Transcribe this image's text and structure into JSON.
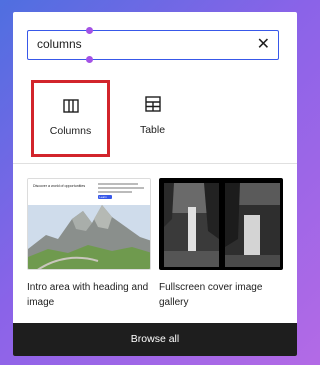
{
  "search": {
    "value": "columns"
  },
  "blocks": [
    {
      "label": "Columns",
      "icon": "columns-icon",
      "selected": true
    },
    {
      "label": "Table",
      "icon": "table-icon",
      "selected": false
    }
  ],
  "patterns": [
    {
      "label": "Intro area with heading and image",
      "thumb_heading": "Discover a world of opportunities",
      "thumb_button": "Learn"
    },
    {
      "label": "Fullscreen cover image gallery"
    }
  ],
  "footer": {
    "browse_label": "Browse all"
  },
  "colors": {
    "accent": "#3858e9",
    "selection": "#d2242b",
    "footer_bg": "#1e1e1e"
  }
}
